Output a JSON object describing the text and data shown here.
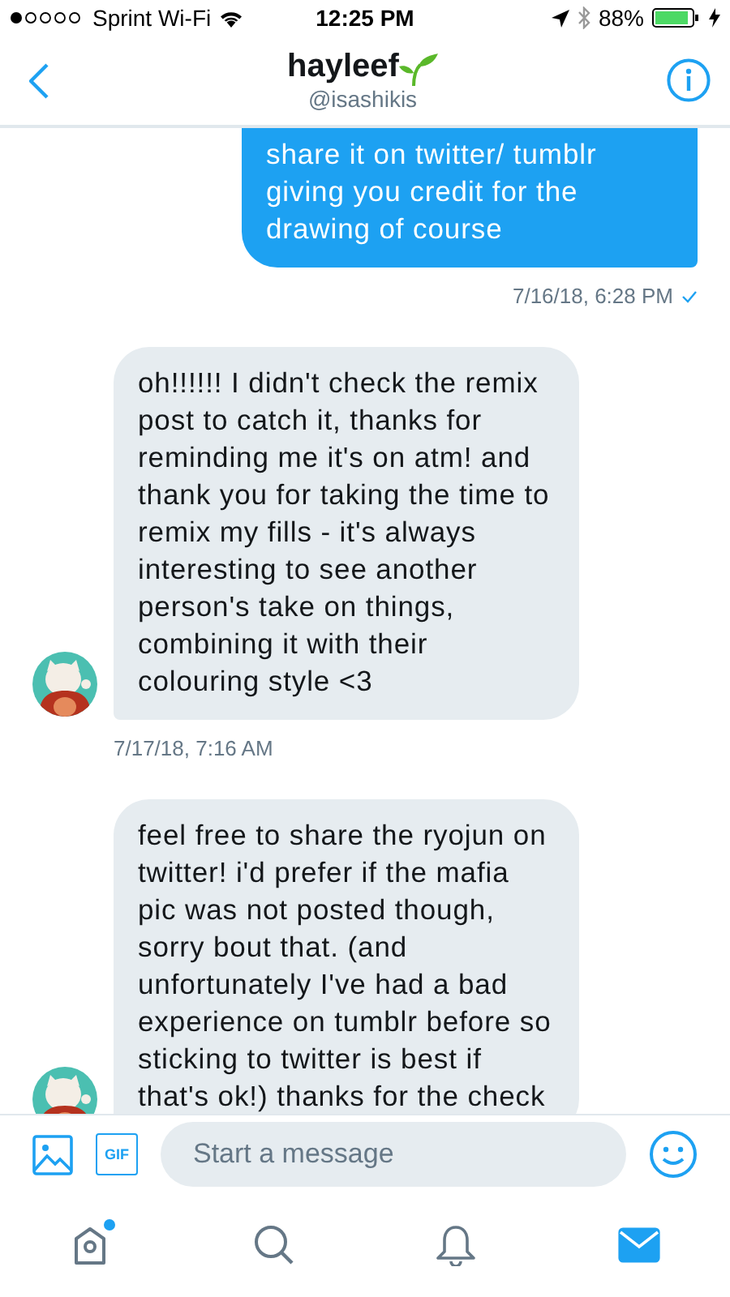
{
  "status_bar": {
    "carrier": "Sprint Wi-Fi",
    "time": "12:25 PM",
    "battery": "88%"
  },
  "header": {
    "name": "hayleef",
    "handle": "@isashikis"
  },
  "messages": [
    {
      "kind": "sent",
      "text": "share it on twitter/ tumblr giving you credit for the drawing of course",
      "time": "7/16/18, 6:28 PM",
      "read": true
    },
    {
      "kind": "received",
      "text": "oh!!!!!! I didn't check the remix post to catch it, thanks for reminding me it's on atm! and thank you for taking the time to remix my fills - it's always interesting to see another person's take on things, combining it with their colouring style <3",
      "time": "7/17/18, 7:16 AM"
    },
    {
      "kind": "received",
      "text": "feel free to share the ryojun on twitter! i'd prefer if the mafia pic was not posted though, sorry bout that. (and unfortunately I've had a bad experience on tumblr before so sticking to twitter is best if that's ok!) thanks for the check"
    }
  ],
  "composer": {
    "gif": "GIF",
    "placeholder": "Start a message"
  },
  "tabs": [
    {
      "kind": "home",
      "selected": false,
      "dot": true
    },
    {
      "kind": "search",
      "selected": false,
      "dot": false
    },
    {
      "kind": "bell",
      "selected": false,
      "dot": false
    },
    {
      "kind": "mail",
      "selected": true,
      "dot": false
    }
  ]
}
